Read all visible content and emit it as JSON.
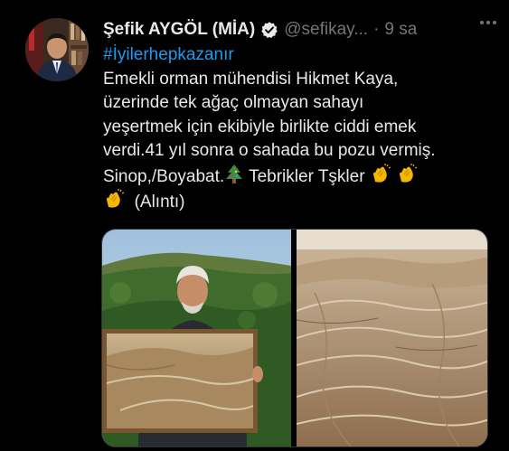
{
  "author": {
    "name": "Şefik AYGÖL (MİA)",
    "handle": "@sefikay...",
    "separator": "·",
    "time": "9 sa"
  },
  "tweet": {
    "hashtag": "#İyilerhepkazanır",
    "lines": [
      "Emekli orman mühendisi Hikmet Kaya,",
      "üzerinde tek ağaç olmayan sahayı",
      "yeşertmek için ekibiyle birlikte ciddi emek",
      "verdi.41 yıl sonra o sahada bu pozu vermiş.",
      "Sinop,/Boyabat.",
      "Tebrikler Tşkler",
      "(Alıntı)"
    ]
  },
  "colors": {
    "background": "#000000",
    "text": "#e7e9ea",
    "secondary": "#71767b",
    "link": "#1d9bf0",
    "verified": "#e7e9ea"
  },
  "icons": {
    "verified": "verified-badge-icon",
    "more": "more-dots-icon",
    "tree": "christmas-tree-emoji",
    "clap": "clapping-hands-emoji"
  }
}
